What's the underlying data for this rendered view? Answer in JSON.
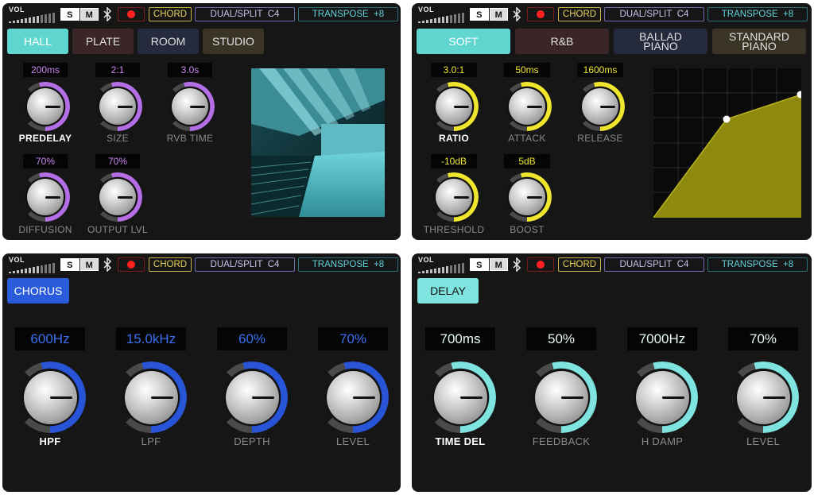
{
  "status_bar": {
    "vol_label": "VOL",
    "solo_label": "S",
    "mute_label": "M",
    "chord_label": "CHORD",
    "dual_label": "DUAL/SPLIT",
    "dual_note": "C4",
    "transpose_label": "TRANSPOSE",
    "transpose_value": "+8"
  },
  "reverb": {
    "tabs": [
      {
        "label": "HALL",
        "active": true
      },
      {
        "label": "PLATE",
        "active": false
      },
      {
        "label": "ROOM",
        "active": false
      },
      {
        "label": "STUDIO",
        "active": false
      }
    ],
    "knobs": [
      {
        "label": "PREDELAY",
        "value": "200ms",
        "active": true
      },
      {
        "label": "SIZE",
        "value": "2:1",
        "active": false
      },
      {
        "label": "RVB TIME",
        "value": "3.0s",
        "active": false
      },
      {
        "label": "DIFFUSION",
        "value": "70%",
        "active": false
      },
      {
        "label": "OUTPUT LVL",
        "value": "70%",
        "active": false
      }
    ],
    "accent": "#b46ee6"
  },
  "compressor": {
    "tabs": [
      {
        "label": "SOFT",
        "active": true
      },
      {
        "label": "R&B",
        "active": false
      },
      {
        "label": "BALLAD PIANO",
        "active": false
      },
      {
        "label": "STANDARD PIANO",
        "active": false
      }
    ],
    "knobs": [
      {
        "label": "RATIO",
        "value": "3.0:1",
        "active": true
      },
      {
        "label": "ATTACK",
        "value": "50ms",
        "active": false
      },
      {
        "label": "RELEASE",
        "value": "1600ms",
        "active": false
      },
      {
        "label": "THRESHOLD",
        "value": "-10dB",
        "active": false
      },
      {
        "label": "BOOST",
        "value": "5dB",
        "active": false
      }
    ],
    "accent": "#f0e62e"
  },
  "chorus": {
    "tab": "CHORUS",
    "knobs": [
      {
        "label": "HPF",
        "value": "600Hz",
        "active": true
      },
      {
        "label": "LPF",
        "value": "15.0kHz",
        "active": false
      },
      {
        "label": "DEPTH",
        "value": "60%",
        "active": false
      },
      {
        "label": "LEVEL",
        "value": "70%",
        "active": false
      }
    ],
    "accent": "#2855d8"
  },
  "delay": {
    "tab": "DELAY",
    "knobs": [
      {
        "label": "TIME DEL",
        "value": "700ms",
        "active": true
      },
      {
        "label": "FEEDBACK",
        "value": "50%",
        "active": false
      },
      {
        "label": "H DAMP",
        "value": "7000Hz",
        "active": false
      },
      {
        "label": "LEVEL",
        "value": "70%",
        "active": false
      }
    ],
    "accent": "#7fe3e0"
  }
}
